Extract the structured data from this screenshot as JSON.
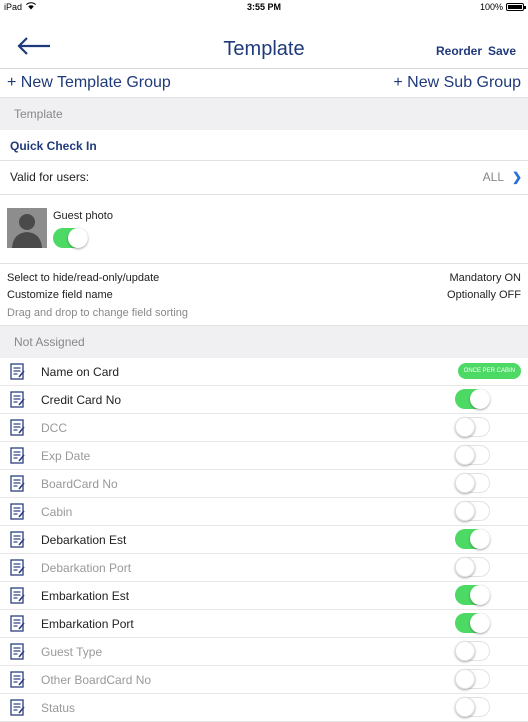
{
  "status": {
    "carrier": "iPad",
    "time": "3:55 PM",
    "battery": "100%"
  },
  "nav": {
    "title": "Template",
    "reorder": "Reorder",
    "save": "Save"
  },
  "groups": {
    "new_group": "+ New Template Group",
    "new_sub": "+ New Sub Group"
  },
  "section_template": "Template",
  "template": {
    "name": "Quick Check In",
    "valid_label": "Valid for users:",
    "valid_value": "ALL"
  },
  "guest_photo": {
    "label": "Guest photo",
    "on": true
  },
  "info": {
    "line1_left": "Select to hide/read-only/update",
    "line1_right": "Mandatory ON",
    "line2_left": "Customize field name",
    "line2_right": "Optionally OFF",
    "line3_left": "Drag and drop to change field sorting"
  },
  "section_not_assigned": "Not Assigned",
  "fields": [
    {
      "name": "Name on Card",
      "active": true,
      "badge": "ONCE PER CABIN"
    },
    {
      "name": "Credit Card No",
      "active": true,
      "on": true
    },
    {
      "name": "DCC",
      "active": false,
      "on": false
    },
    {
      "name": "Exp Date",
      "active": false,
      "on": false
    },
    {
      "name": "BoardCard No",
      "active": false,
      "on": false
    },
    {
      "name": "Cabin",
      "active": false,
      "on": false
    },
    {
      "name": "Debarkation Est",
      "active": true,
      "on": true
    },
    {
      "name": "Debarkation Port",
      "active": false,
      "on": false
    },
    {
      "name": "Embarkation Est",
      "active": true,
      "on": true
    },
    {
      "name": "Embarkation Port",
      "active": true,
      "on": true
    },
    {
      "name": "Guest Type",
      "active": false,
      "on": false
    },
    {
      "name": "Other BoardCard No",
      "active": false,
      "on": false
    },
    {
      "name": "Status",
      "active": false,
      "on": false
    }
  ],
  "colors": {
    "accent": "#1f3a7a",
    "switch_on": "#4cd964",
    "link": "#2a6fd8"
  }
}
